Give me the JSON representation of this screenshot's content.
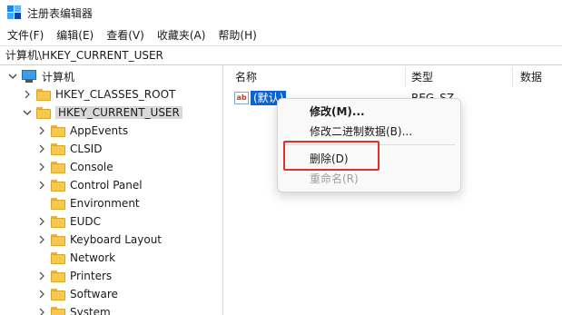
{
  "window": {
    "title": "注册表编辑器"
  },
  "menu": [
    "文件(F)",
    "编辑(E)",
    "查看(V)",
    "收藏夹(A)",
    "帮助(H)"
  ],
  "address": "计算机\\HKEY_CURRENT_USER",
  "tree": {
    "root": "计算机",
    "hives": [
      "HKEY_CLASSES_ROOT",
      "HKEY_CURRENT_USER"
    ],
    "children": [
      "AppEvents",
      "CLSID",
      "Console",
      "Control Panel",
      "Environment",
      "EUDC",
      "Keyboard Layout",
      "Network",
      "Printers",
      "Software",
      "System"
    ]
  },
  "list": {
    "columns": [
      "名称",
      "类型",
      "数据"
    ],
    "rows": [
      {
        "icon": "string-value-icon",
        "name": "(默认)",
        "type": "REG_SZ"
      }
    ]
  },
  "context_menu": {
    "items": [
      "修改(M)...",
      "修改二进制数据(B)...",
      "删除(D)",
      "重命名(R)"
    ]
  },
  "colors": {
    "selection": "#0a64d3",
    "highlight_box": "#e0312b",
    "folder": "#f6c94e"
  }
}
